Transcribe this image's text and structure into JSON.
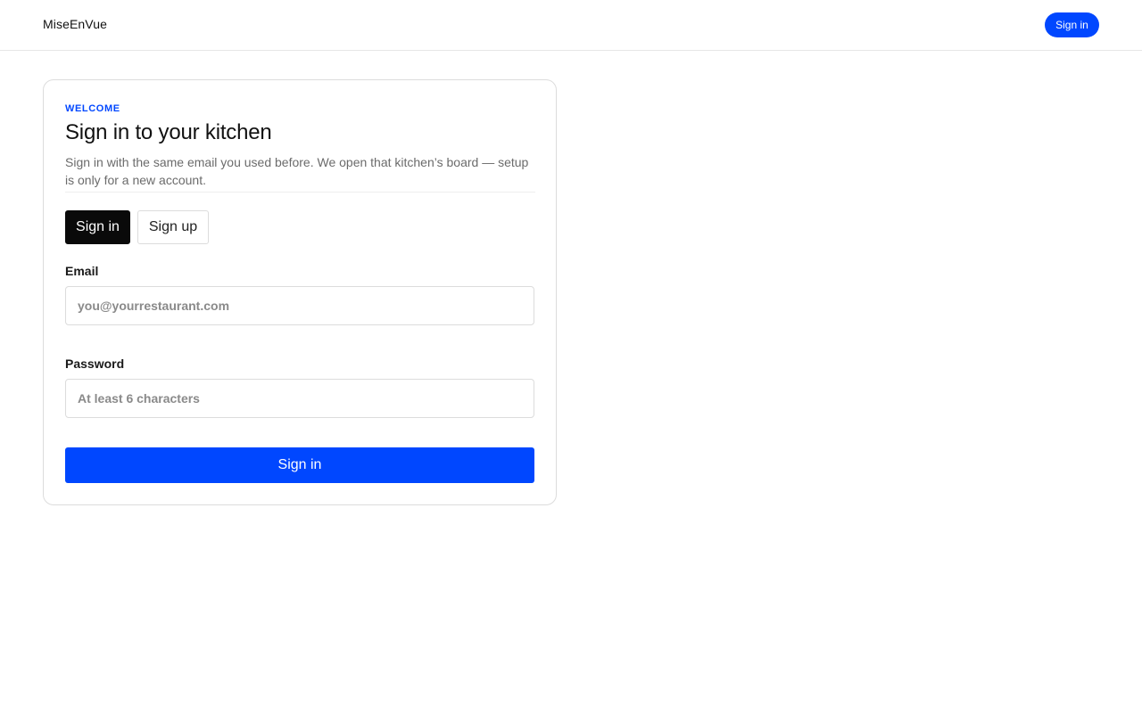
{
  "header": {
    "brand": "MiseEnVue",
    "signin_label": "Sign in"
  },
  "card": {
    "eyebrow": "WELCOME",
    "title": "Sign in to your kitchen",
    "description": "Sign in with the same email you used before. We open that kitchen’s board — setup is only for a new account.",
    "tabs": [
      {
        "label": "Sign in",
        "active": true
      },
      {
        "label": "Sign up",
        "active": false
      }
    ],
    "email": {
      "label": "Email",
      "value": "",
      "placeholder": "you@yourrestaurant.com"
    },
    "password": {
      "label": "Password",
      "value": "",
      "placeholder": "At least 6 characters"
    },
    "submit_label": "Sign in"
  },
  "colors": {
    "accent": "#0047ff",
    "active_tab": "#0a0a0a",
    "muted_text": "#6b6b6b",
    "border": "#dcdcdc"
  }
}
